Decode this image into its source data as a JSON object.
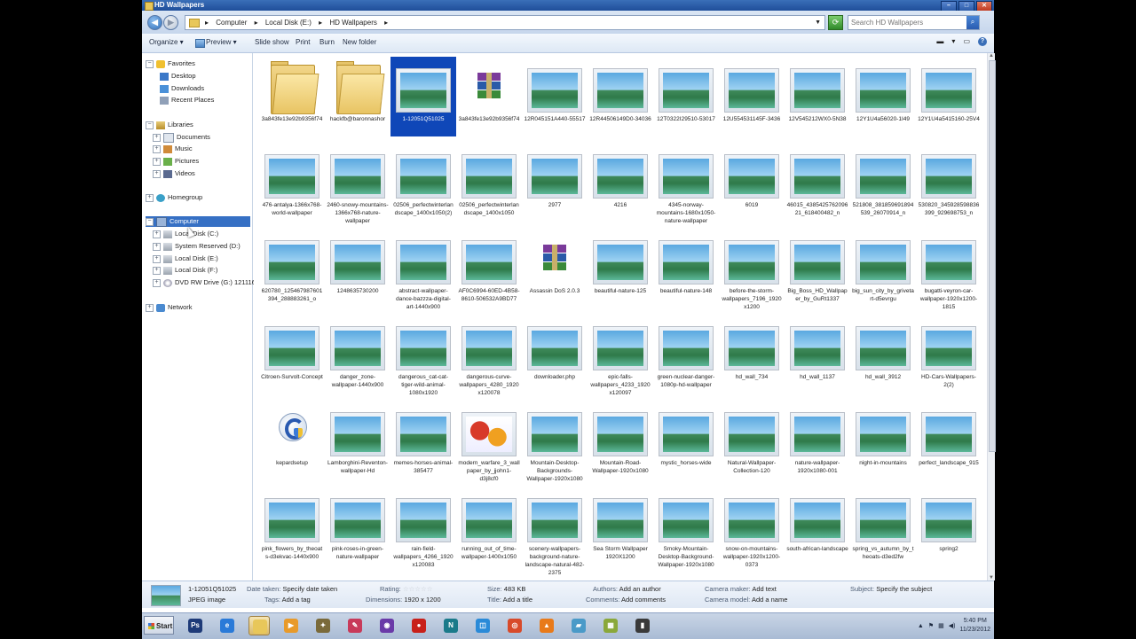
{
  "window": {
    "title": "HD Wallpapers",
    "minimize": "–",
    "maximize": "□",
    "close": "✕"
  },
  "address": {
    "crumbs": [
      "Computer",
      "Local Disk (E:)",
      "HD Wallpapers"
    ],
    "separator": "▸"
  },
  "search": {
    "placeholder": "Search HD Wallpapers",
    "icon": "search-icon"
  },
  "toolbar": {
    "organize": "Organize ▾",
    "preview": "Preview ▾",
    "slideshow": "Slide show",
    "print": "Print",
    "burn": "Burn",
    "new_folder": "New folder"
  },
  "nav": {
    "favorites": "Favorites",
    "desktop": "Desktop",
    "downloads": "Downloads",
    "recent": "Recent Places",
    "libraries": "Libraries",
    "documents": "Documents",
    "music": "Music",
    "pictures": "Pictures",
    "videos": "Videos",
    "homegroup": "Homegroup",
    "computer": "Computer",
    "local_c": "Local Disk (C:)",
    "sys_reserved": "System Reserved (D:)",
    "local_e": "Local Disk (E:)",
    "local_f": "Local Disk (F:)",
    "dvd": "DVD RW Drive (G:) 121116",
    "network": "Network"
  },
  "files": [
    {
      "label": "3a843fe13e92b9356f74",
      "kind": "folder"
    },
    {
      "label": "hackfb@baronnashor",
      "kind": "folder"
    },
    {
      "label": "1-12051Q51025",
      "kind": "image",
      "selected": true
    },
    {
      "label": "3a843fe13e92b9356f74",
      "kind": "rar"
    },
    {
      "label": "12R045151A440-55517",
      "kind": "image"
    },
    {
      "label": "12R44506149D0-34036",
      "kind": "image"
    },
    {
      "label": "12T0322I29510-53017",
      "kind": "image"
    },
    {
      "label": "12U554531145F-3436",
      "kind": "image"
    },
    {
      "label": "12V545212WX0-5N38",
      "kind": "image"
    },
    {
      "label": "12Y1U4a56020-1I49",
      "kind": "image"
    },
    {
      "label": "12Y1U4a5415160-25V4",
      "kind": "image"
    },
    {
      "label": "476-antalya-1366x768-world-wallpaper",
      "kind": "image"
    },
    {
      "label": "2460-snowy-mountains-1366x768-nature-wallpaper",
      "kind": "image"
    },
    {
      "label": "02506_perfectwinterlandscape_1400x1050(2)",
      "kind": "image"
    },
    {
      "label": "02506_perfectwinterlandscape_1400x1050",
      "kind": "image"
    },
    {
      "label": "2977",
      "kind": "image"
    },
    {
      "label": "4216",
      "kind": "image"
    },
    {
      "label": "4345-norway-mountains-1680x1050-nature-wallpaper",
      "kind": "image"
    },
    {
      "label": "6019",
      "kind": "image"
    },
    {
      "label": "46015_438542576209621_618400482_n",
      "kind": "image"
    },
    {
      "label": "521808_381859691894539_26070914_n",
      "kind": "image"
    },
    {
      "label": "530820_345928598836399_929698753_n",
      "kind": "image"
    },
    {
      "label": "620780_125467987601394_288883261_o",
      "kind": "image"
    },
    {
      "label": "1248635730200",
      "kind": "image"
    },
    {
      "label": "abstract-wallpaper-dance-bazzza-digital-art-1440x900",
      "kind": "image"
    },
    {
      "label": "AF0C6994-60ED-4B58-8610-506532A9BD77",
      "kind": "image"
    },
    {
      "label": "Assassin DoS 2.0.3",
      "kind": "rar"
    },
    {
      "label": "beautiful-nature-125",
      "kind": "image"
    },
    {
      "label": "beautiful-nature-148",
      "kind": "image"
    },
    {
      "label": "before-the-storm-wallpapers_7196_1920x1200",
      "kind": "image"
    },
    {
      "label": "Big_Boss_HD_Wallpaper_by_GuRt1337",
      "kind": "image"
    },
    {
      "label": "big_sun_city_by_grivetart-d5evrgu",
      "kind": "image"
    },
    {
      "label": "bugatti-veyron-car-wallpaper-1920x1200-1815",
      "kind": "image"
    },
    {
      "label": "Citroen-Survolt-Concept",
      "kind": "image"
    },
    {
      "label": "danger_zone-wallpaper-1440x900",
      "kind": "image"
    },
    {
      "label": "dangerous_cat-cat-tiger-wild-animal-1080x1920",
      "kind": "image"
    },
    {
      "label": "dangerous-curve-wallpapers_4280_1920x120078",
      "kind": "image"
    },
    {
      "label": "downloader.php",
      "kind": "image"
    },
    {
      "label": "epic-falls-wallpapers_4233_1920x120097",
      "kind": "image"
    },
    {
      "label": "green-nuclear-danger-1080p-hd-wallpaper",
      "kind": "image"
    },
    {
      "label": "hd_wall_734",
      "kind": "image"
    },
    {
      "label": "hd_wall_1137",
      "kind": "image"
    },
    {
      "label": "hd_wall_3912",
      "kind": "image"
    },
    {
      "label": "HD-Cars-Wallpapers-2(2)",
      "kind": "image"
    },
    {
      "label": "kepardsetup",
      "kind": "setup"
    },
    {
      "label": "Lamborghini-Reventon-wallpaper-Hd",
      "kind": "image"
    },
    {
      "label": "memes-horses-animal-385477",
      "kind": "image"
    },
    {
      "label": "modern_warfare_3_wallpaper_by_jjohn1-d3j8cf0",
      "kind": "flowers"
    },
    {
      "label": "Mountain-Desktop-Backgrounds-Wallpaper-1920x1080",
      "kind": "image"
    },
    {
      "label": "Mountain-Road-Wallpaper-1920x1080",
      "kind": "image"
    },
    {
      "label": "mystic_horses-wide",
      "kind": "image"
    },
    {
      "label": "Natural-Wallpaper-Collection-120",
      "kind": "image"
    },
    {
      "label": "nature-wallpaper-1920x1080-001",
      "kind": "image"
    },
    {
      "label": "night-in-mountains",
      "kind": "image"
    },
    {
      "label": "perfect_landscape_915",
      "kind": "image"
    },
    {
      "label": "pink_flowers_by_theoats-d3ekvac-1440x900",
      "kind": "image"
    },
    {
      "label": "pink-roses-in-green-nature-wallpaper",
      "kind": "image"
    },
    {
      "label": "rain-field-wallpapers_4266_1920x120083",
      "kind": "image"
    },
    {
      "label": "running_out_of_time-wallpaper-1400x1050",
      "kind": "image"
    },
    {
      "label": "scenery-wallpapers-background-nature-landscape-natural-482-2375",
      "kind": "image"
    },
    {
      "label": "Sea Storm Wallpaper 1920X1200",
      "kind": "image"
    },
    {
      "label": "Smoky-Mountain-Desktop-Background-Wallpaper-1920x1080",
      "kind": "image"
    },
    {
      "label": "snow-on-mountains-wallpaper-1920x1200-0373",
      "kind": "image"
    },
    {
      "label": "south-african-landscape",
      "kind": "image"
    },
    {
      "label": "spring_vs_autumn_by_theoats-d3ed2fw",
      "kind": "image"
    },
    {
      "label": "spring2",
      "kind": "image"
    }
  ],
  "details": {
    "name": "1-12051Q51025",
    "type": "JPEG image",
    "date_taken_k": "Date taken:",
    "date_taken_v": "Specify date taken",
    "tags_k": "Tags:",
    "tags_v": "Add a tag",
    "rating_k": "Rating:",
    "rating_v": "☆☆☆☆☆",
    "dimensions_k": "Dimensions:",
    "dimensions_v": "1920 x 1200",
    "size_k": "Size:",
    "size_v": "483 KB",
    "title_k": "Title:",
    "title_v": "Add a title",
    "authors_k": "Authors:",
    "authors_v": "Add an author",
    "comments_k": "Comments:",
    "comments_v": "Add comments",
    "camera_maker_k": "Camera maker:",
    "camera_maker_v": "Add text",
    "camera_model_k": "Camera model:",
    "camera_model_v": "Add a name",
    "subject_k": "Subject:",
    "subject_v": "Specify the subject"
  },
  "taskbar": {
    "start": "Start",
    "apps": [
      {
        "name": "photoshop-icon",
        "glyph": "Ps",
        "color": "#1e3a78"
      },
      {
        "name": "internet-explorer-icon",
        "glyph": "e",
        "color": "#2a7ad8"
      },
      {
        "name": "windows-explorer-icon",
        "glyph": "",
        "color": "#e8c75a",
        "active": true
      },
      {
        "name": "media-player-icon",
        "glyph": "▶",
        "color": "#e89a2a"
      },
      {
        "name": "game-icon",
        "glyph": "✦",
        "color": "#7a6a3a"
      },
      {
        "name": "paint-icon",
        "glyph": "✎",
        "color": "#c83a5a"
      },
      {
        "name": "torrent-icon",
        "glyph": "◉",
        "color": "#6a3aa8"
      },
      {
        "name": "red-tool-icon",
        "glyph": "●",
        "color": "#c8201a"
      },
      {
        "name": "notepad-icon",
        "glyph": "N",
        "color": "#1a7a8a"
      },
      {
        "name": "app-blue-icon",
        "glyph": "◫",
        "color": "#2a8ad8"
      },
      {
        "name": "chrome-icon",
        "glyph": "◎",
        "color": "#d84a2a"
      },
      {
        "name": "vlc-icon",
        "glyph": "▲",
        "color": "#e87a1a"
      },
      {
        "name": "blue-app-icon",
        "glyph": "▰",
        "color": "#4a9ac8"
      },
      {
        "name": "green-app-icon",
        "glyph": "▦",
        "color": "#8aa83a"
      },
      {
        "name": "dark-app-icon",
        "glyph": "▮",
        "color": "#3a3a3a"
      }
    ],
    "time": "5:40 PM",
    "date": "11/23/2012"
  }
}
